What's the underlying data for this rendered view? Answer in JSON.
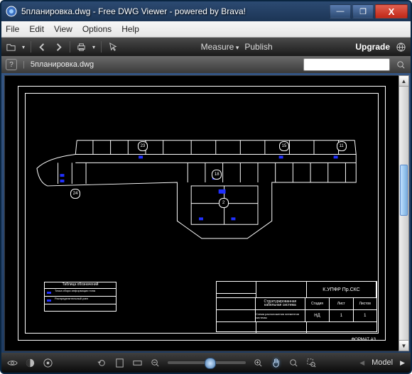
{
  "window": {
    "title": "5планировка.dwg - Free DWG Viewer - powered by Brava!"
  },
  "menu": {
    "file": "File",
    "edit": "Edit",
    "view": "View",
    "options": "Options",
    "help": "Help"
  },
  "toolbar": {
    "measure": "Measure",
    "publish": "Publish",
    "upgrade": "Upgrade"
  },
  "doc": {
    "filename": "5планировка.dwg",
    "help_glyph": "?"
  },
  "statusbar": {
    "mode_label": "Model"
  },
  "titleblock": {
    "project": "К.УПФР Пр.СКС",
    "system1": "Структурированная",
    "system2": "кабельная система",
    "desc": "Схема  расположения  элементов системы",
    "hdr1": "Стадия",
    "hdr2": "Лист",
    "hdr3": "Листов",
    "val1": "НД",
    "val2": "1",
    "val3": "1",
    "format": "ФОРМАТ   А3"
  },
  "legend": {
    "title": "Таблица  обозначений",
    "row1": "Точка сбора информации типа",
    "row2": "Распределительный узел"
  },
  "nodes": {
    "n1": "23",
    "n2": "15",
    "n3": "11",
    "n4": "18",
    "n5": "2",
    "n6": "24"
  },
  "winctl": {
    "min": "—",
    "max": "❐",
    "close": "X"
  }
}
